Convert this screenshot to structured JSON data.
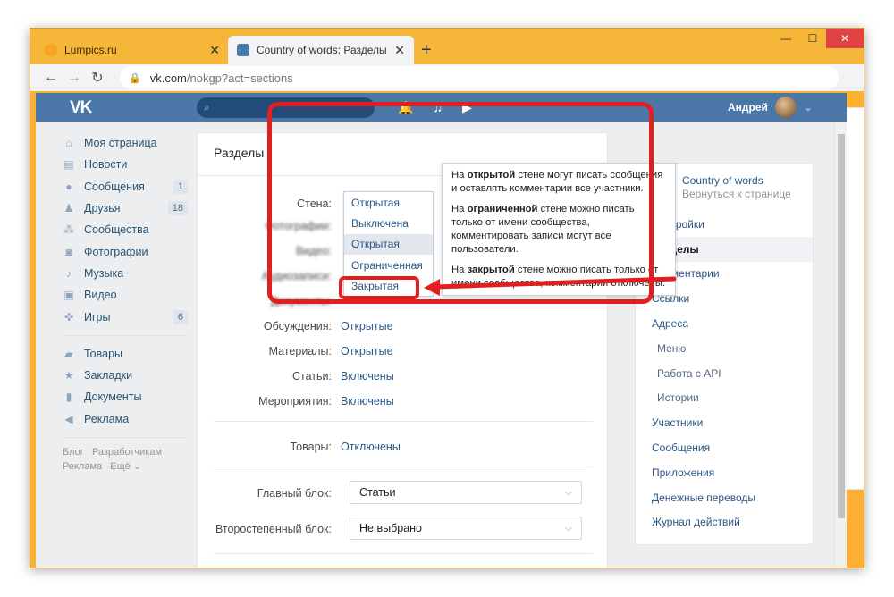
{
  "browser": {
    "tabs": [
      {
        "label": "Lumpics.ru",
        "favicon_color": "#f5a623"
      },
      {
        "label": "Country of words: Разделы",
        "favicon_color": "#4a76a8"
      }
    ],
    "url_host": "vk.com",
    "url_path": "/nokgp?act=sections"
  },
  "vk": {
    "logo": "VK",
    "user_name": "Андрей"
  },
  "sidebar": {
    "items": [
      {
        "label": "Моя страница",
        "icon": "home-icon",
        "count": ""
      },
      {
        "label": "Новости",
        "icon": "news-icon",
        "count": ""
      },
      {
        "label": "Сообщения",
        "icon": "messages-icon",
        "count": "1"
      },
      {
        "label": "Друзья",
        "icon": "friends-icon",
        "count": "18"
      },
      {
        "label": "Сообщества",
        "icon": "groups-icon",
        "count": ""
      },
      {
        "label": "Фотографии",
        "icon": "photos-icon",
        "count": ""
      },
      {
        "label": "Музыка",
        "icon": "music-icon",
        "count": ""
      },
      {
        "label": "Видео",
        "icon": "video-icon",
        "count": ""
      },
      {
        "label": "Игры",
        "icon": "games-icon",
        "count": "6"
      }
    ],
    "items2": [
      {
        "label": "Товары",
        "icon": "goods-icon"
      },
      {
        "label": "Закладки",
        "icon": "bookmarks-icon"
      },
      {
        "label": "Документы",
        "icon": "docs-icon"
      },
      {
        "label": "Реклама",
        "icon": "ads-icon"
      }
    ],
    "footer": [
      "Блог",
      "Разработчикам",
      "Реклама",
      "Ещё ⌄"
    ]
  },
  "main": {
    "title": "Разделы",
    "wall_label": "Стена:",
    "wall_options": [
      "Открытая",
      "Выключена",
      "Открытая",
      "Ограниченная",
      "Закрытая"
    ],
    "blurred_labels": [
      "Фотографии:",
      "Видео:",
      "Аудиозаписи:",
      "Документы:"
    ],
    "rows": [
      {
        "label": "Обсуждения:",
        "value": "Открытые"
      },
      {
        "label": "Материалы:",
        "value": "Открытые"
      },
      {
        "label": "Статьи:",
        "value": "Включены"
      },
      {
        "label": "Мероприятия:",
        "value": "Включены"
      }
    ],
    "goods_label": "Товары:",
    "goods_value": "Отключены",
    "main_block_label": "Главный блок:",
    "main_block_value": "Статьи",
    "second_block_label": "Второстепенный блок:",
    "second_block_value": "Не выбрано"
  },
  "tooltip": {
    "p1_a": "На ",
    "p1_b": "открытой",
    "p1_c": " стене могут писать сообщения и оставлять комментарии все участники.",
    "p2_a": "На ",
    "p2_b": "ограниченной",
    "p2_c": " стене можно писать только от имени сообщества, комментировать записи могут все пользователи.",
    "p3_a": "На ",
    "p3_b": "закрытой",
    "p3_c": " стене можно писать только от имени сообщества, комментарии отключены."
  },
  "right_menu": {
    "group_name": "Country of words",
    "back_link": "Вернуться к странице",
    "items": [
      {
        "label": "Настройки",
        "sub": false,
        "active": false
      },
      {
        "label": "Разделы",
        "sub": false,
        "active": true
      },
      {
        "label": "Комментарии",
        "sub": false,
        "active": false
      },
      {
        "label": "Ссылки",
        "sub": false,
        "active": false
      },
      {
        "label": "Адреса",
        "sub": false,
        "active": false
      },
      {
        "label": "Меню",
        "sub": true,
        "active": false
      },
      {
        "label": "Работа с API",
        "sub": true,
        "active": false
      },
      {
        "label": "Истории",
        "sub": true,
        "active": false
      },
      {
        "label": "Участники",
        "sub": false,
        "active": false
      },
      {
        "label": "Сообщения",
        "sub": false,
        "active": false
      },
      {
        "label": "Приложения",
        "sub": false,
        "active": false
      },
      {
        "label": "Денежные переводы",
        "sub": false,
        "active": false
      },
      {
        "label": "Журнал действий",
        "sub": false,
        "active": false
      }
    ]
  },
  "colors": {
    "vk_blue": "#4a76a8",
    "highlight_red": "#e21f1f",
    "browser_orange": "#f5b63a"
  }
}
